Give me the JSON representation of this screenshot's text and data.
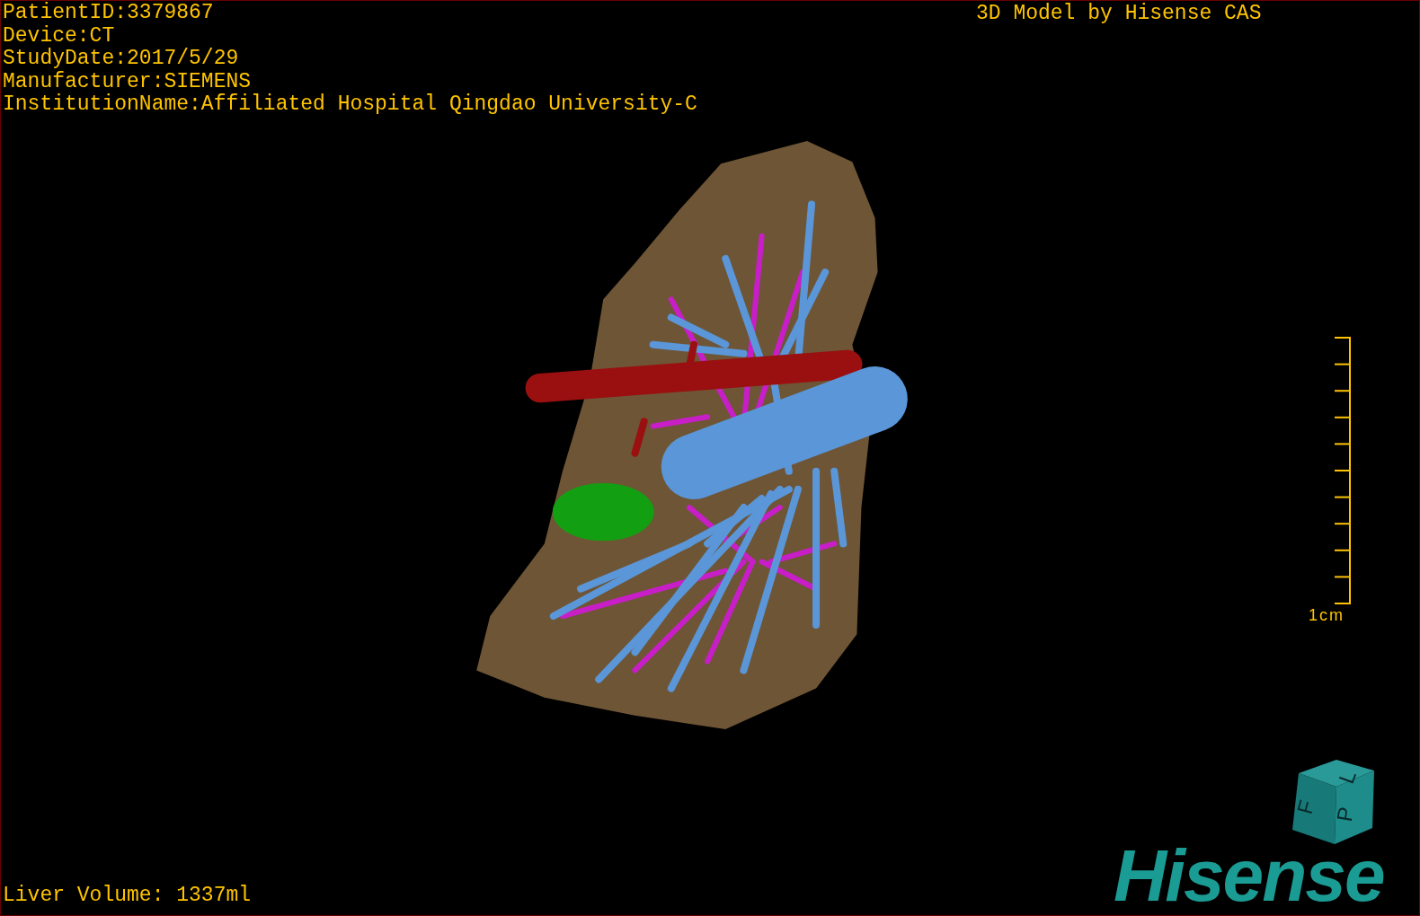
{
  "patient_info": [
    "PatientID:3379867",
    "Device:CT",
    "StudyDate:2017/5/29",
    "Manufacturer:SIEMENS",
    "InstitutionName:Affiliated Hospital Qingdao University-C"
  ],
  "title": "3D Model by Hisense CAS",
  "scale_bar": {
    "label": "1cm"
  },
  "orientation_cube": {
    "faces": [
      "F",
      "L",
      "P"
    ]
  },
  "logo": "Hisense",
  "footer": "Liver Volume: 1337ml"
}
